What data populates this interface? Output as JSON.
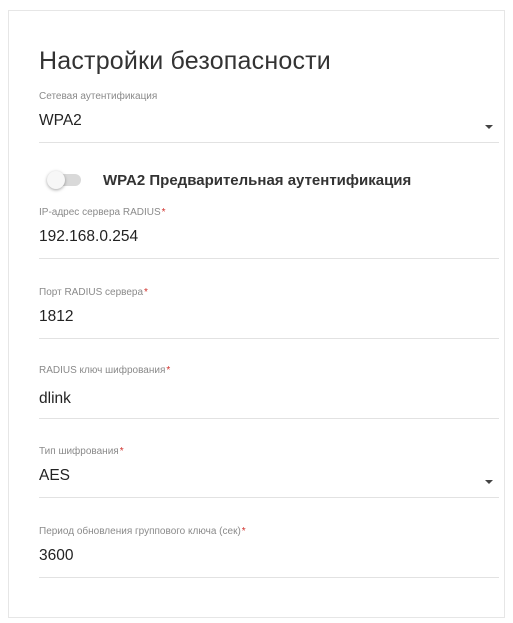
{
  "title": "Настройки безопасности",
  "network_auth": {
    "label": "Сетевая аутентификация",
    "value": "WPA2"
  },
  "preauth": {
    "label": "WPA2 Предварительная аутентификация",
    "enabled": false
  },
  "radius_ip": {
    "label": "IP-адрес сервера RADIUS",
    "required_mark": "*",
    "value": "192.168.0.254"
  },
  "radius_port": {
    "label": "Порт RADIUS сервера",
    "required_mark": "*",
    "value": "1812"
  },
  "radius_key": {
    "label": "RADIUS ключ шифрования",
    "required_mark": "*",
    "value": "dlink"
  },
  "encryption": {
    "label": "Тип шифрования",
    "required_mark": "*",
    "value": "AES"
  },
  "group_key_period": {
    "label": "Период обновления группового ключа (сек)",
    "required_mark": "*",
    "value": "3600"
  },
  "colors": {
    "required": "#d0302b",
    "toggle_off_track": "#d9d9d9"
  },
  "icons": {
    "dropdown": "chevron-down-icon"
  }
}
